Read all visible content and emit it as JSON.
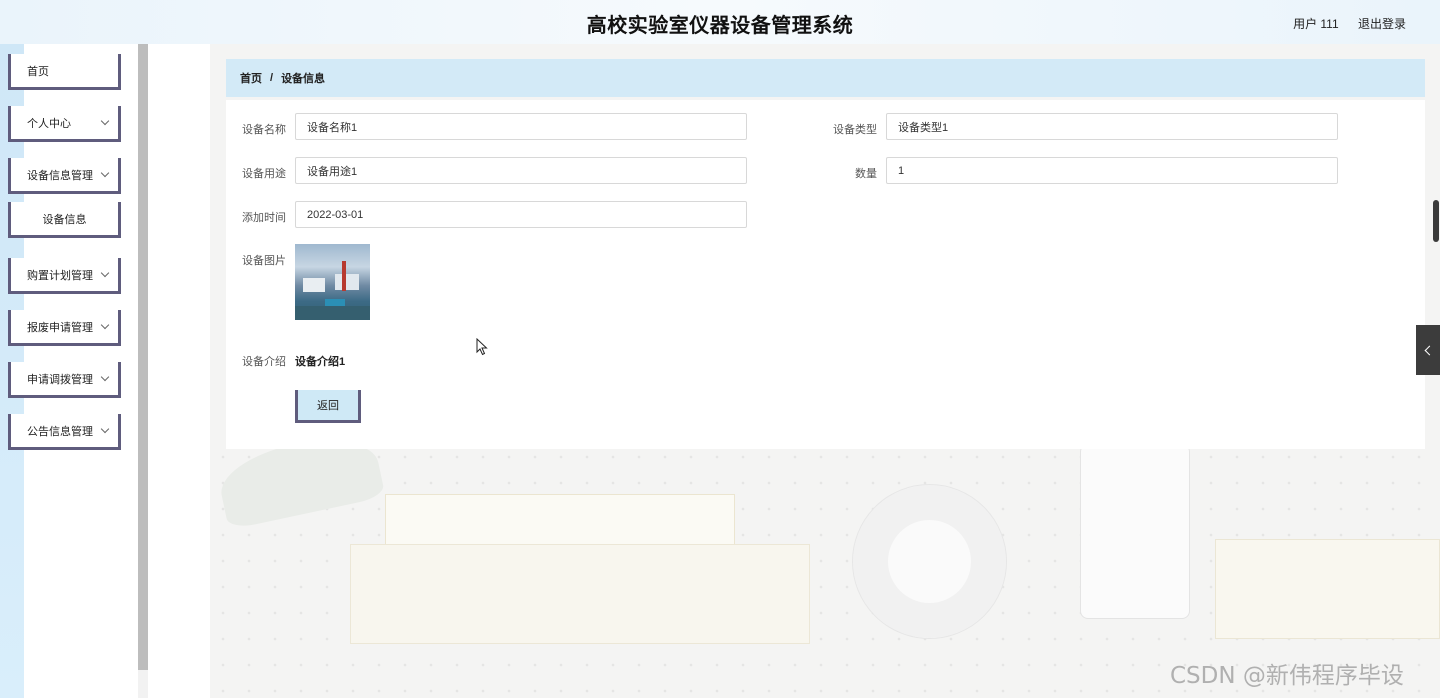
{
  "header": {
    "app_title": "高校实验室仪器设备管理系统",
    "user_label": "用户 111",
    "logout_label": "退出登录"
  },
  "sidebar": {
    "items": [
      {
        "label": "首页",
        "has_children": false
      },
      {
        "label": "个人中心",
        "has_children": true
      },
      {
        "label": "设备信息管理",
        "has_children": true
      },
      {
        "label": "设备信息",
        "has_children": false,
        "submenu": true
      },
      {
        "label": "购置计划管理",
        "has_children": true
      },
      {
        "label": "报废申请管理",
        "has_children": true
      },
      {
        "label": "申请调拨管理",
        "has_children": true
      },
      {
        "label": "公告信息管理",
        "has_children": true
      }
    ]
  },
  "breadcrumb": {
    "home": "首页",
    "separator": "/",
    "current": "设备信息"
  },
  "form": {
    "device_name": {
      "label": "设备名称",
      "value": "设备名称1"
    },
    "device_type": {
      "label": "设备类型",
      "value": "设备类型1"
    },
    "device_use": {
      "label": "设备用途",
      "value": "设备用途1"
    },
    "quantity": {
      "label": "数量",
      "value": "1"
    },
    "added_time": {
      "label": "添加时间",
      "value": "2022-03-01"
    },
    "device_image": {
      "label": "设备图片"
    },
    "device_intro": {
      "label": "设备介绍",
      "value": "设备介绍1"
    },
    "back_label": "返回"
  },
  "watermark": "CSDN @新伟程序毕设",
  "colors": {
    "accent_border": "#5f5c7d",
    "breadcrumb_bg": "#d3eaf7",
    "header_bg": "#eaf4fb"
  }
}
